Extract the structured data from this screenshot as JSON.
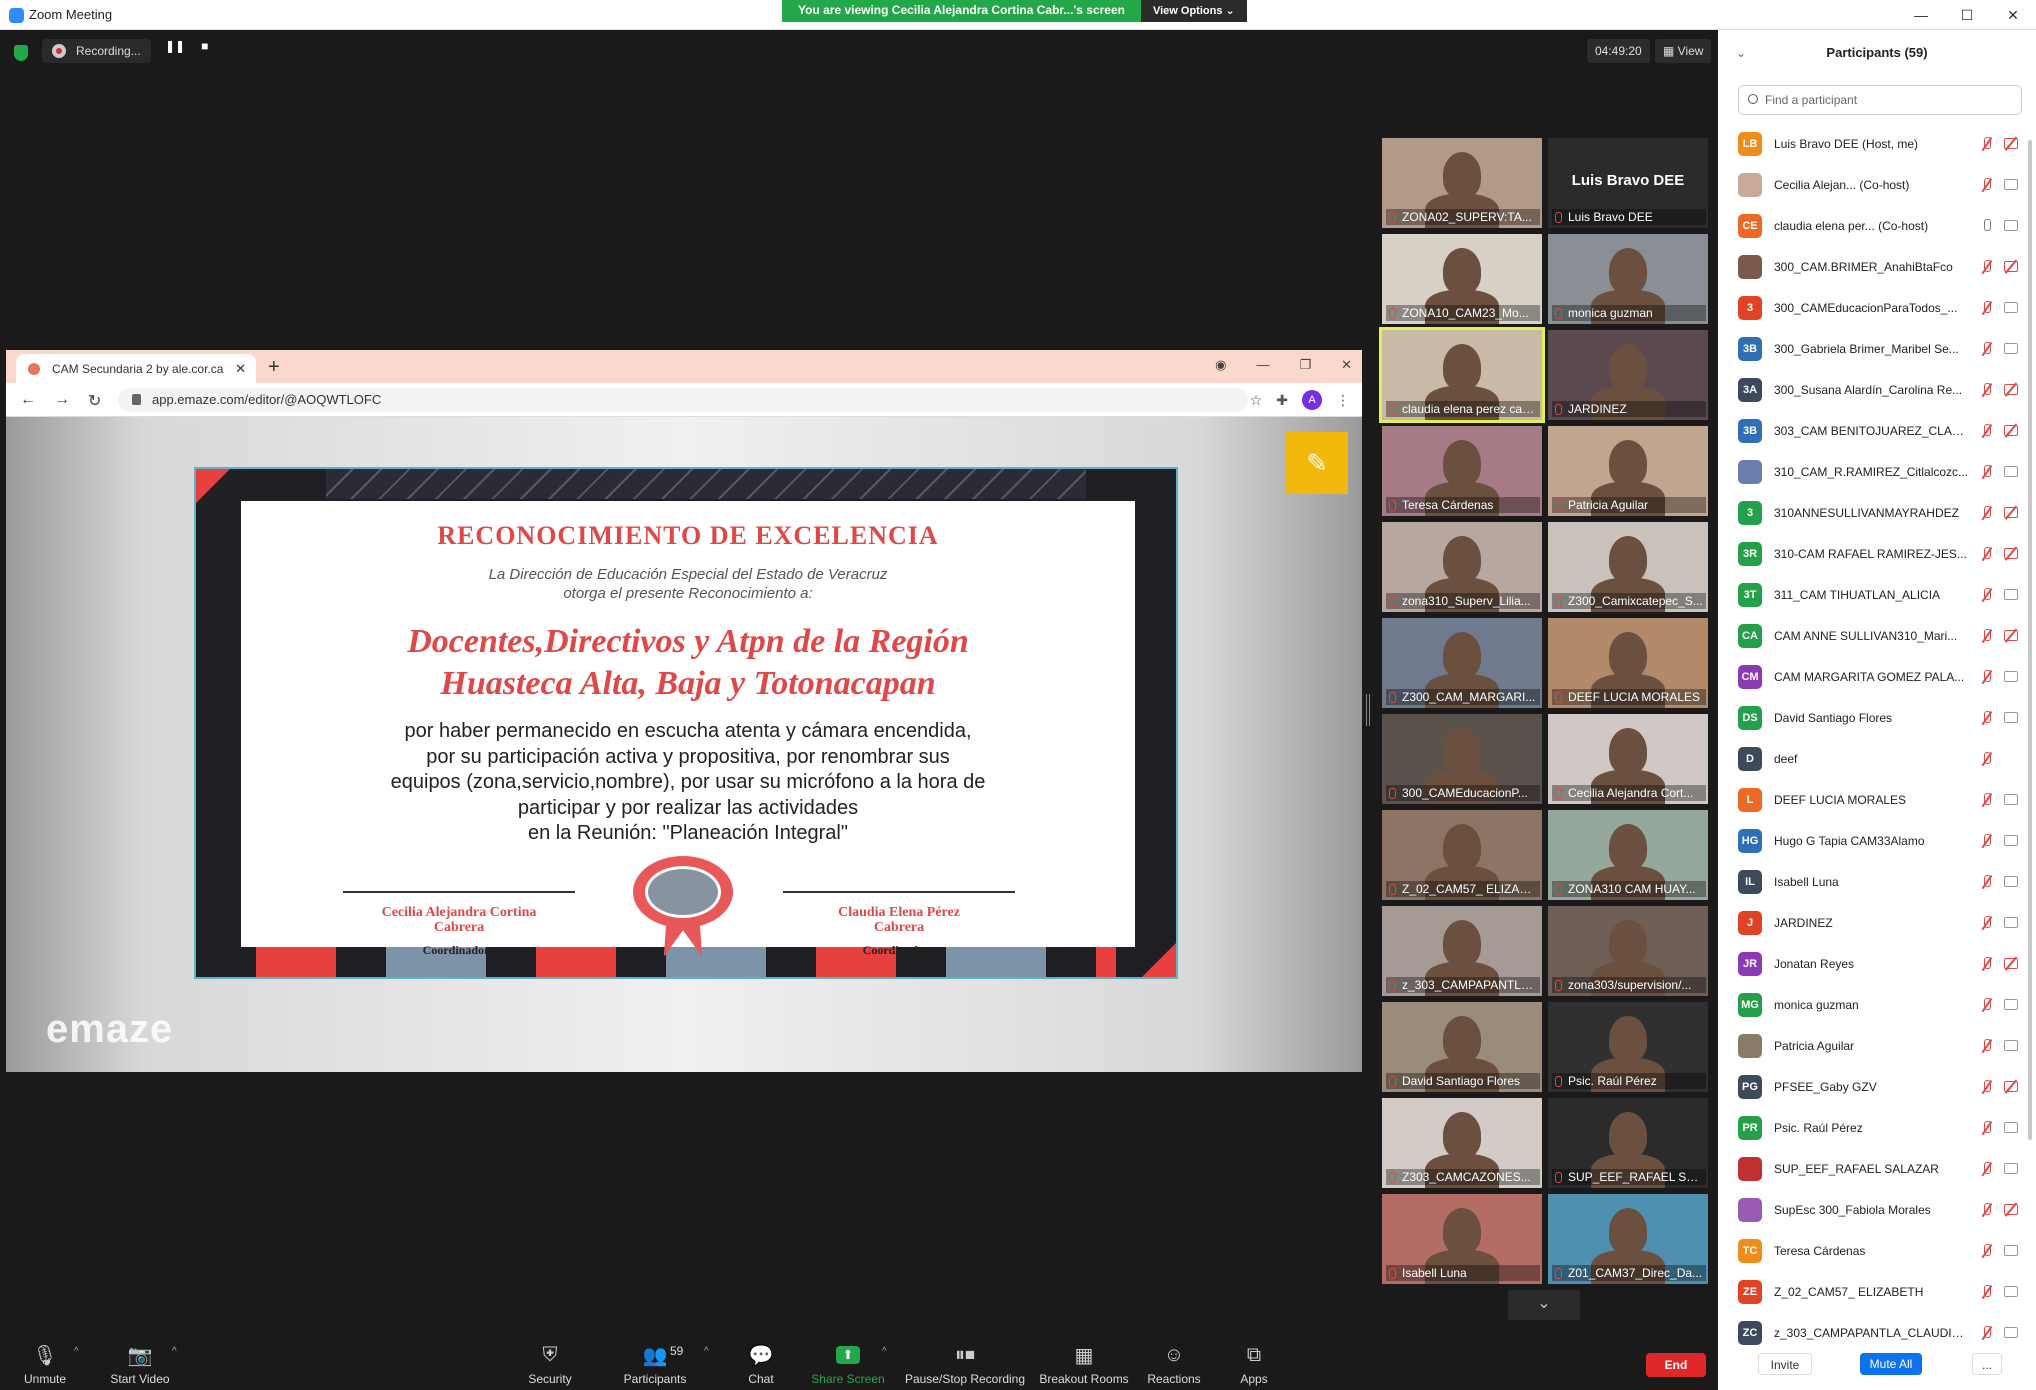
{
  "window": {
    "title": "Zoom Meeting",
    "banner_text": "You are viewing Cecilia Alejandra Cortina Cabr...'s screen",
    "view_options": "View Options ⌄"
  },
  "topbar": {
    "recording": "Recording...",
    "timer": "04:49:20",
    "view": "View"
  },
  "browser": {
    "tab_title": "CAM Secundaria 2 by ale.cor.ca",
    "url": "app.emaze.com/editor/@AOQWTLOFC",
    "profile_letter": "A",
    "watermark": "emaze"
  },
  "certificate": {
    "title": "RECONOCIMIENTO DE EXCELENCIA",
    "subtitle_1": "La Dirección de Educación Especial del Estado de Veracruz",
    "subtitle_2": "otorga el presente Reconocimiento a:",
    "recipients_1": "Docentes,Directivos y Atpn de la Región",
    "recipients_2": "Huasteca Alta, Baja y Totonacapan",
    "body": [
      "por haber  permanecido en escucha atenta y cámara encendida,",
      "por su participación activa y propositiva,  por renombrar sus",
      "equipos (zona,servicio,nombre), por usar su micrófono a la hora de",
      "participar y por realizar las actividades",
      "en la Reunión: \"Planeación Integral\""
    ],
    "signer_left_1": "Cecilia Alejandra Cortina",
    "signer_left_2": "Cabrera",
    "signer_right_1": "Claudia Elena Pérez",
    "signer_right_2": "Cabrera",
    "role": "Coordinadora"
  },
  "gallery": [
    {
      "label": "ZONA02_SUPERV:TA...",
      "color": "#b29a86"
    },
    {
      "label": "Luis Bravo DEE",
      "color": "#2b2b2b",
      "bigname": "Luis Bravo DEE"
    },
    {
      "label": "ZONA10_CAM23_Mo...",
      "color": "#d7d0c6"
    },
    {
      "label": "monica guzman",
      "color": "#8a8f95"
    },
    {
      "label": "claudia elena perez cabr...",
      "color": "#c9b9a6",
      "active": true
    },
    {
      "label": "JARDINEZ",
      "color": "#5a4a50"
    },
    {
      "label": "Teresa Cárdenas",
      "color": "#a77b86"
    },
    {
      "label": "Patricia Aguilar",
      "color": "#c2a58f"
    },
    {
      "label": "zona310_Superv_Lilia...",
      "color": "#b8a7a0"
    },
    {
      "label": "Z300_Camixcatepec_S...",
      "color": "#c8c2bb"
    },
    {
      "label": "Z300_CAM_MARGARI...",
      "color": "#6f7a8e"
    },
    {
      "label": "DEEF LUCIA MORALES",
      "color": "#b28a6a"
    },
    {
      "label": "300_CAMEducacionP...",
      "color": "#5c524c"
    },
    {
      "label": "Cecilia Alejandra Cort...",
      "color": "#cfc8c4"
    },
    {
      "label": "Z_02_CAM57_ ELIZAB...",
      "color": "#8d7464"
    },
    {
      "label": "ZONA310 CAM HUAY...",
      "color": "#95a69a"
    },
    {
      "label": "z_303_CAMPAPANTLA...",
      "color": "#a59a94"
    },
    {
      "label": "zona303/supervision/...",
      "color": "#6e5e56"
    },
    {
      "label": "David Santiago Flores",
      "color": "#9a8b7a"
    },
    {
      "label": "Psic. Raúl Pérez",
      "color": "#303030"
    },
    {
      "label": "Z303_CAMCAZONES...",
      "color": "#d3ccc6"
    },
    {
      "label": "SUP_EEF_RAFAEL SAL...",
      "color": "#2b2b2b"
    },
    {
      "label": "Isabell Luna",
      "color": "#b46c64"
    },
    {
      "label": "Z01_CAM37_Direc_Da...",
      "color": "#4f8fb0"
    }
  ],
  "toolbar": {
    "unmute": "Unmute",
    "start_video": "Start Video",
    "security": "Security",
    "participants": "Participants",
    "participants_count": "59",
    "chat": "Chat",
    "share_screen": "Share Screen",
    "pause_recording": "Pause/Stop Recording",
    "breakout": "Breakout Rooms",
    "reactions": "Reactions",
    "apps": "Apps",
    "end": "End"
  },
  "participants_panel": {
    "title": "Participants (59)",
    "search_placeholder": "Find a participant",
    "invite": "Invite",
    "mute_all": "Mute All",
    "more": "...",
    "list": [
      {
        "initials": "LB",
        "name": "Luis Bravo DEE (Host, me)",
        "color": "#f08c1a",
        "mic": "off",
        "cam": "off"
      },
      {
        "initials": "",
        "name": "Cecilia Alejan...  (Co-host)",
        "color": "#c9a89a",
        "mic": "off",
        "cam": "on"
      },
      {
        "initials": "CE",
        "name": "claudia elena per...  (Co-host)",
        "color": "#ee6a24",
        "mic": "on",
        "cam": "on"
      },
      {
        "initials": "",
        "name": "300_CAM.BRIMER_AnahiBtaFco",
        "color": "#7a5a4a",
        "mic": "off",
        "cam": "off"
      },
      {
        "initials": "3",
        "name": "300_CAMEducacionParaTodos_...",
        "color": "#e04226",
        "mic": "off",
        "cam": "on"
      },
      {
        "initials": "3B",
        "name": "300_Gabriela Brimer_Maribel Se...",
        "color": "#2f6fb5",
        "mic": "off",
        "cam": "on"
      },
      {
        "initials": "3A",
        "name": "300_Susana Alardín_Carolina Re...",
        "color": "#3d4a5c",
        "mic": "off",
        "cam": "off"
      },
      {
        "initials": "3B",
        "name": "303_CAM BENITOJUAREZ_CLAU...",
        "color": "#2f6fb5",
        "mic": "off",
        "cam": "off"
      },
      {
        "initials": "",
        "name": "310_CAM_R.RAMIREZ_Citlalcozc...",
        "color": "#6a7fb0",
        "mic": "off",
        "cam": "on"
      },
      {
        "initials": "3",
        "name": "310ANNESULLIVANMAYRAHDEZ",
        "color": "#24a04a",
        "mic": "off",
        "cam": "off"
      },
      {
        "initials": "3R",
        "name": "310-CAM RAFAEL RAMIREZ-JES...",
        "color": "#24a04a",
        "mic": "off",
        "cam": "off"
      },
      {
        "initials": "3T",
        "name": "311_CAM TIHUATLAN_ALICIA",
        "color": "#24a04a",
        "mic": "off",
        "cam": "on"
      },
      {
        "initials": "CA",
        "name": "CAM ANNE SULLIVAN310_Mari...",
        "color": "#24a04a",
        "mic": "off",
        "cam": "off"
      },
      {
        "initials": "CM",
        "name": "CAM MARGARITA GOMEZ PALA...",
        "color": "#8a3ab4",
        "mic": "off",
        "cam": "on"
      },
      {
        "initials": "DS",
        "name": "David Santiago Flores",
        "color": "#24a04a",
        "mic": "off",
        "cam": "on"
      },
      {
        "initials": "D",
        "name": "deef",
        "color": "#3d4a5c",
        "mic": "off",
        "cam": "none"
      },
      {
        "initials": "L",
        "name": "DEEF LUCIA MORALES",
        "color": "#ee6a24",
        "mic": "off",
        "cam": "on"
      },
      {
        "initials": "HG",
        "name": "Hugo G Tapia CAM33Alamo",
        "color": "#2f6fb5",
        "mic": "off",
        "cam": "on"
      },
      {
        "initials": "IL",
        "name": "Isabell Luna",
        "color": "#3d4a5c",
        "mic": "off",
        "cam": "on"
      },
      {
        "initials": "J",
        "name": "JARDINEZ",
        "color": "#e04226",
        "mic": "off",
        "cam": "on"
      },
      {
        "initials": "JR",
        "name": "Jonatan Reyes",
        "color": "#8a3ab4",
        "mic": "off",
        "cam": "off"
      },
      {
        "initials": "MG",
        "name": "monica guzman",
        "color": "#24a04a",
        "mic": "off",
        "cam": "on"
      },
      {
        "initials": "",
        "name": "Patricia Aguilar",
        "color": "#8a7a6a",
        "mic": "off",
        "cam": "on"
      },
      {
        "initials": "PG",
        "name": "PFSEE_Gaby GZV",
        "color": "#3d4a5c",
        "mic": "off",
        "cam": "off"
      },
      {
        "initials": "PR",
        "name": "Psic. Raúl Pérez",
        "color": "#24a04a",
        "mic": "off",
        "cam": "on"
      },
      {
        "initials": "",
        "name": "SUP_EEF_RAFAEL SALAZAR",
        "color": "#c03030",
        "mic": "off",
        "cam": "on"
      },
      {
        "initials": "",
        "name": "SupEsc 300_Fabiola Morales",
        "color": "#9a5ab4",
        "mic": "off",
        "cam": "off"
      },
      {
        "initials": "TC",
        "name": "Teresa Cárdenas",
        "color": "#f08c1a",
        "mic": "off",
        "cam": "on"
      },
      {
        "initials": "ZE",
        "name": "Z_02_CAM57_ ELIZABETH",
        "color": "#e04226",
        "mic": "off",
        "cam": "on"
      },
      {
        "initials": "ZC",
        "name": "z_303_CAMPAPANTLA_CLAUDIA ...",
        "color": "#3d4a5c",
        "mic": "off",
        "cam": "on"
      }
    ]
  }
}
